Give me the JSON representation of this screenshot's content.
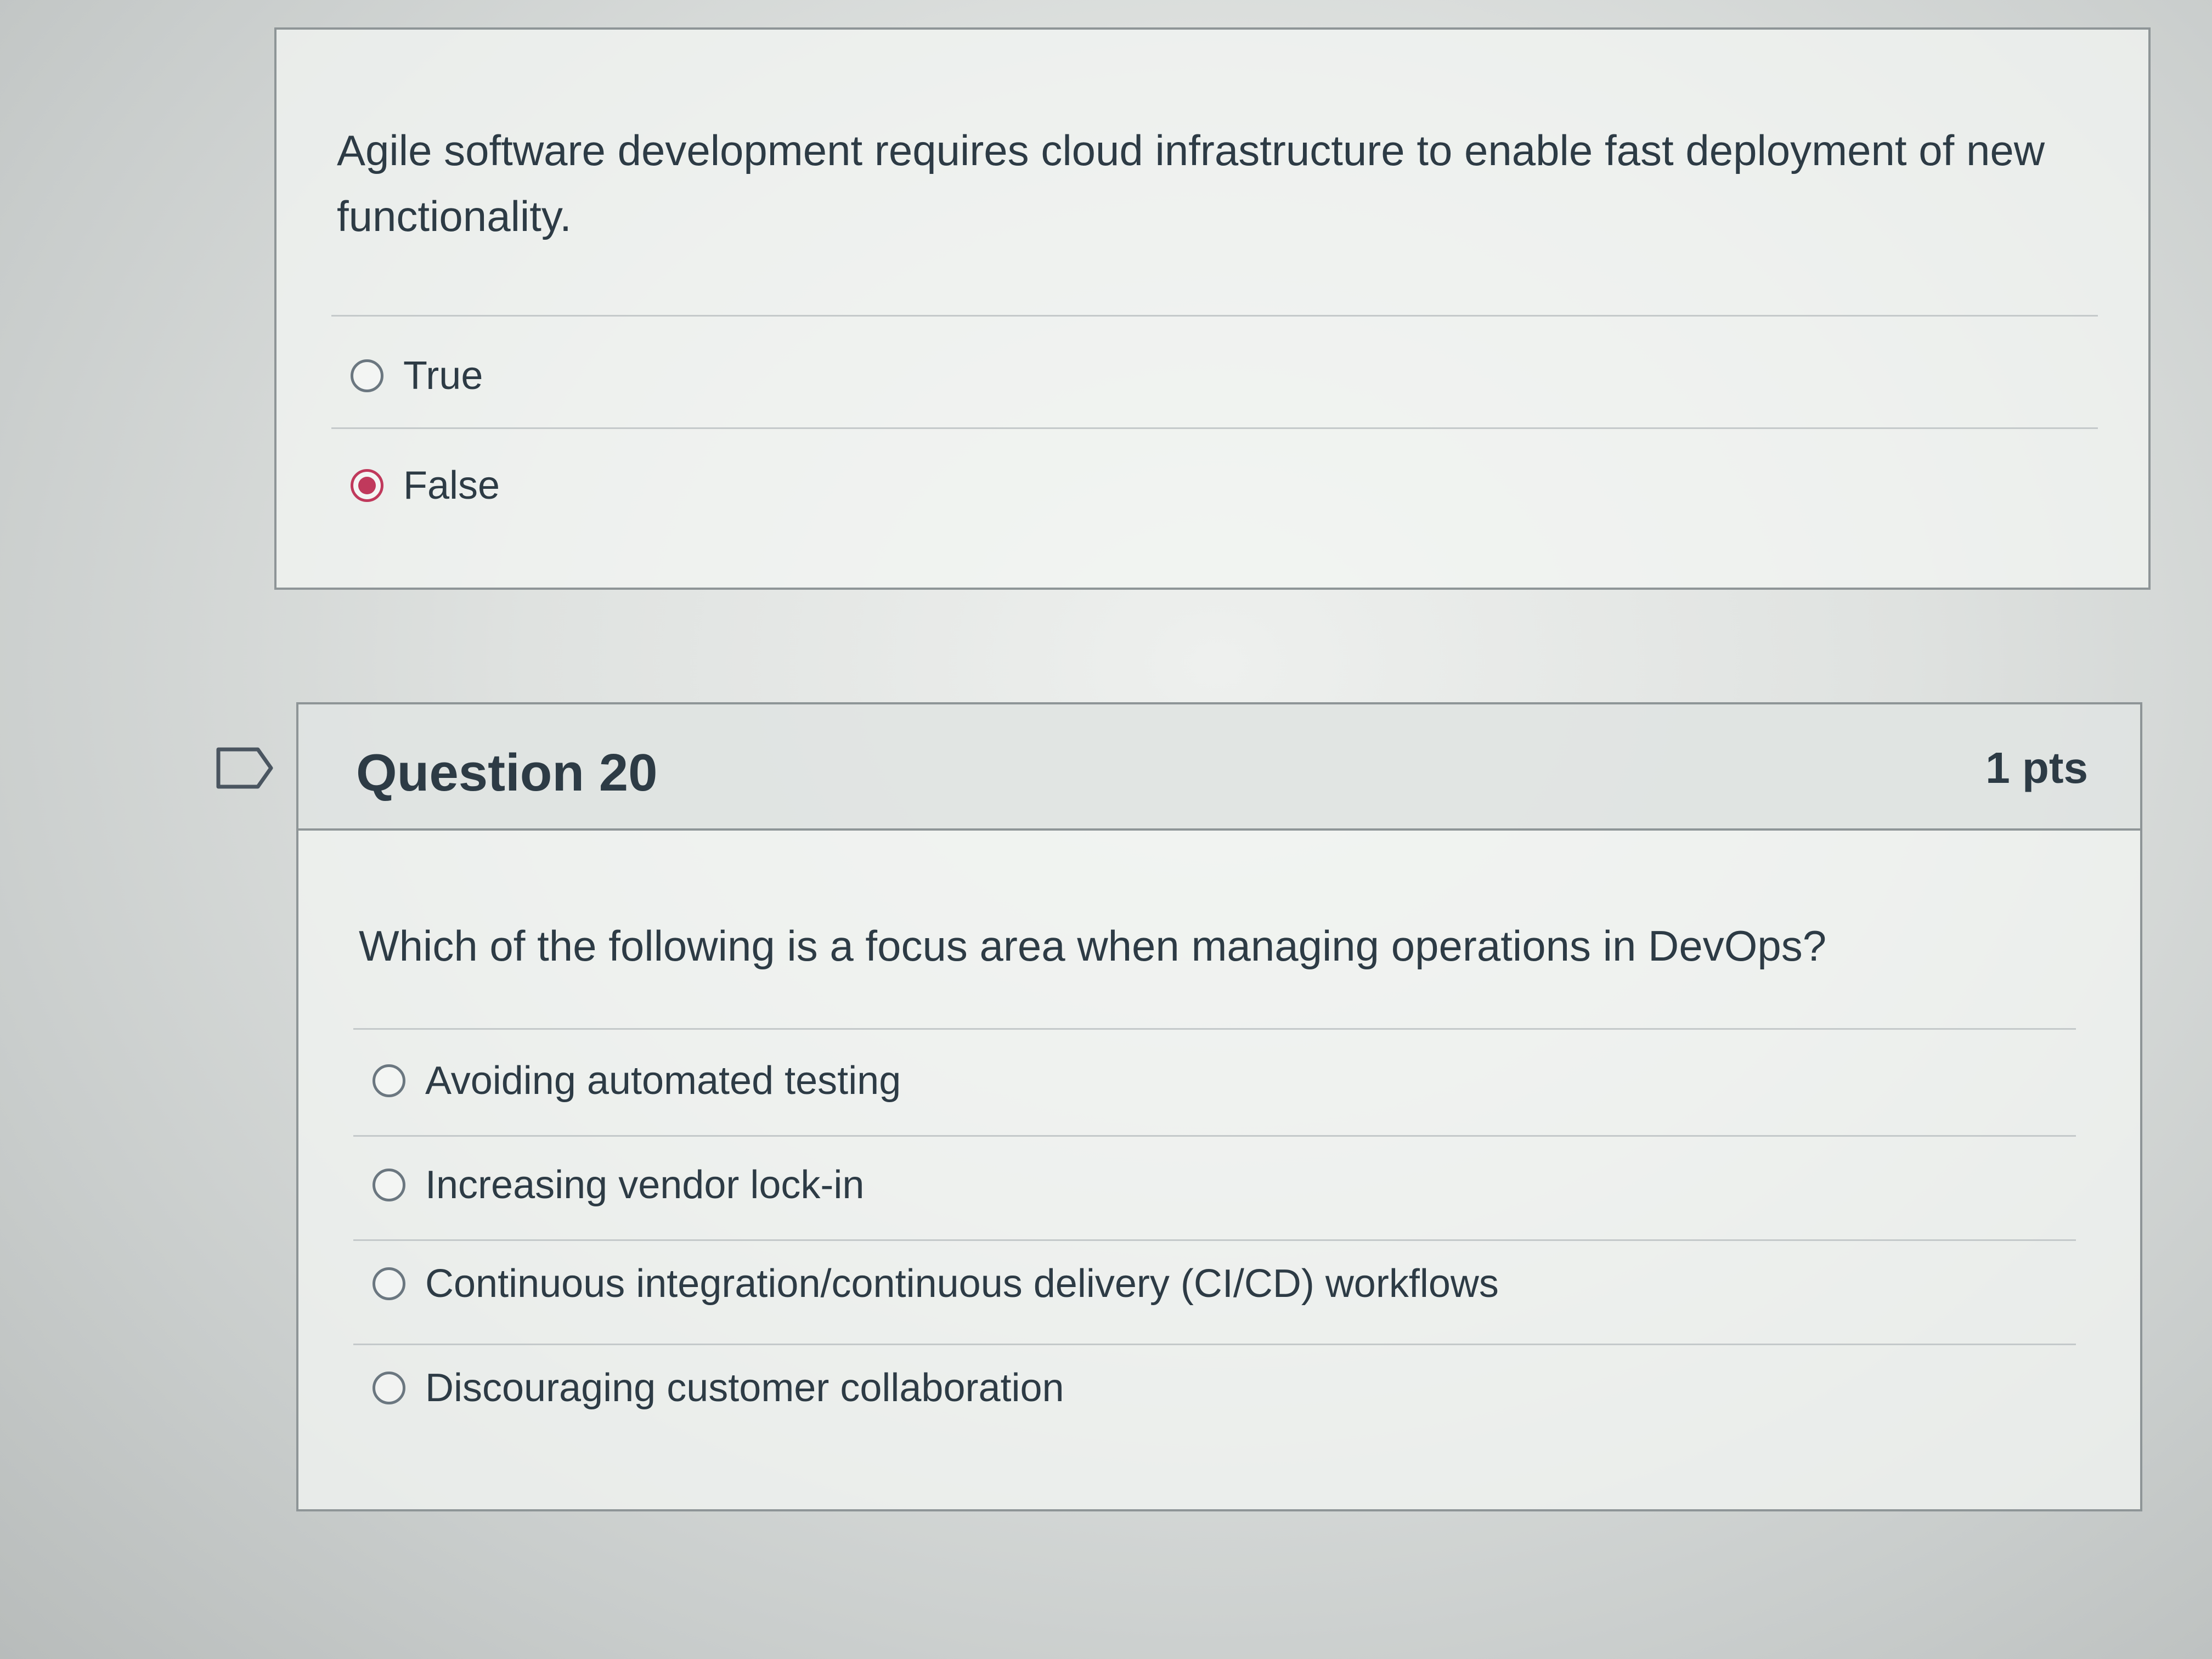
{
  "question_19": {
    "text": "Agile software development requires cloud infrastructure to enable fast deployment of new functionality.",
    "answers": [
      {
        "label": "True",
        "selected": false
      },
      {
        "label": "False",
        "selected": true
      }
    ]
  },
  "question_20": {
    "title": "Question 20",
    "points": "1 pts",
    "text": "Which of the following is a focus area when managing operations in DevOps?",
    "answers": [
      {
        "label": "Avoiding automated testing",
        "selected": false
      },
      {
        "label": "Increasing vendor lock-in",
        "selected": false
      },
      {
        "label": "Continuous integration/continuous delivery (CI/CD) workflows",
        "selected": false
      },
      {
        "label": "Discouraging customer collaboration",
        "selected": false
      }
    ]
  },
  "colors": {
    "selected_radio": "#c0395c",
    "text": "#2d3b45",
    "border": "#8e9597"
  },
  "icons": {
    "flag": "flag-icon"
  }
}
